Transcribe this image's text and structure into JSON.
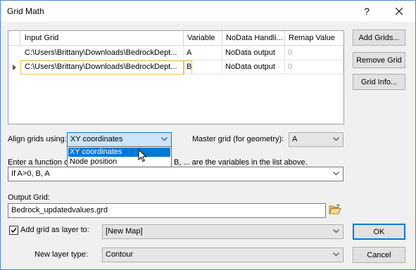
{
  "window": {
    "title": "Grid Math",
    "help_glyph": "?",
    "close_glyph": "✕"
  },
  "grid": {
    "columns": [
      "Input Grid",
      "Variable",
      "NoData Handli...",
      "Remap Value"
    ],
    "rows": [
      {
        "input": "C:\\Users\\Brittany\\Downloads\\BedrockDept...",
        "variable": "A",
        "nodata": "NoData output",
        "remap": "0"
      },
      {
        "input": "C:\\Users\\Brittany\\Downloads\\BedrockDept...",
        "variable": "B",
        "nodata": "NoData output",
        "remap": "0"
      }
    ]
  },
  "side_buttons": {
    "add": "Add Grids...",
    "remove": "Remove Grid",
    "info": "Grid Info..."
  },
  "align": {
    "label": "Align grids using:",
    "value": "XY coordinates",
    "options": [
      "XY coordinates",
      "Node position"
    ]
  },
  "master": {
    "label": "Master grid (for geometry):",
    "value": "A"
  },
  "function": {
    "label_start": "Enter a function o",
    "label_end": "B, ... are the variables in the list above.",
    "value": "If A>0, B, A"
  },
  "output": {
    "label": "Output Grid:",
    "value": "Bedrock_updatedvalues.grd"
  },
  "add_layer": {
    "label": "Add grid as layer to:",
    "checked": true,
    "value": "[New Map]"
  },
  "layer_type": {
    "label": "New layer type:",
    "value": "Contour"
  },
  "dialog_buttons": {
    "ok": "OK",
    "cancel": "Cancel"
  },
  "colors": {
    "accent": "#0078d7",
    "focus_outline": "#f0c24a"
  }
}
